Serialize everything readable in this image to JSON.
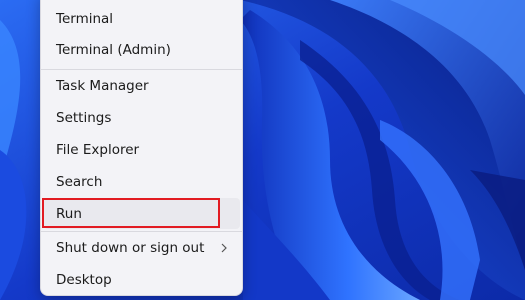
{
  "menu": {
    "items": [
      {
        "label": "Terminal"
      },
      {
        "label": "Terminal (Admin)"
      },
      {
        "label": "Task Manager"
      },
      {
        "label": "Settings"
      },
      {
        "label": "File Explorer"
      },
      {
        "label": "Search"
      },
      {
        "label": "Run"
      },
      {
        "label": "Shut down or sign out",
        "icon": "chevron-right-icon"
      },
      {
        "label": "Desktop"
      }
    ]
  },
  "annotation": {
    "highlighted_item": "Run",
    "color": "#e21b22"
  },
  "colors": {
    "menu_background": "#f3f3f7",
    "wallpaper_primary": "#1a3fd6"
  }
}
